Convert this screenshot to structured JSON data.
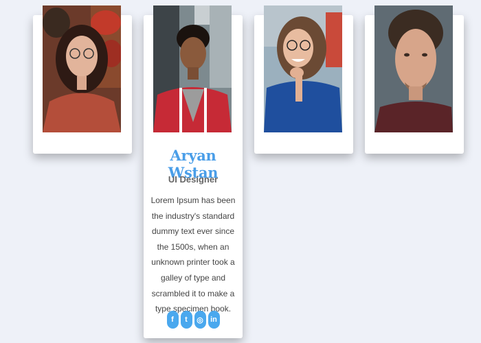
{
  "cards": [
    {
      "name": "",
      "role": "",
      "bio": ""
    },
    {
      "name": "Aryan Wstan",
      "role": "UI Designer",
      "bio": "Lorem Ipsum has been the industry's standard dummy text ever since the 1500s, when an unknown printer took a galley of type and scrambled it to make a type specimen book."
    },
    {
      "name": "",
      "role": "",
      "bio": ""
    },
    {
      "name": "",
      "role": "",
      "bio": ""
    }
  ],
  "social_icons": [
    {
      "icon": "facebook-icon",
      "glyph": "f"
    },
    {
      "icon": "twitter-icon",
      "glyph": "t"
    },
    {
      "icon": "instagram-icon",
      "glyph": "◎"
    },
    {
      "icon": "linkedin-icon",
      "glyph": "in"
    }
  ],
  "colors": {
    "background": "#eef1f8",
    "card": "#ffffff",
    "accent": "#4a9ee8",
    "social": "#4aa8ee"
  }
}
